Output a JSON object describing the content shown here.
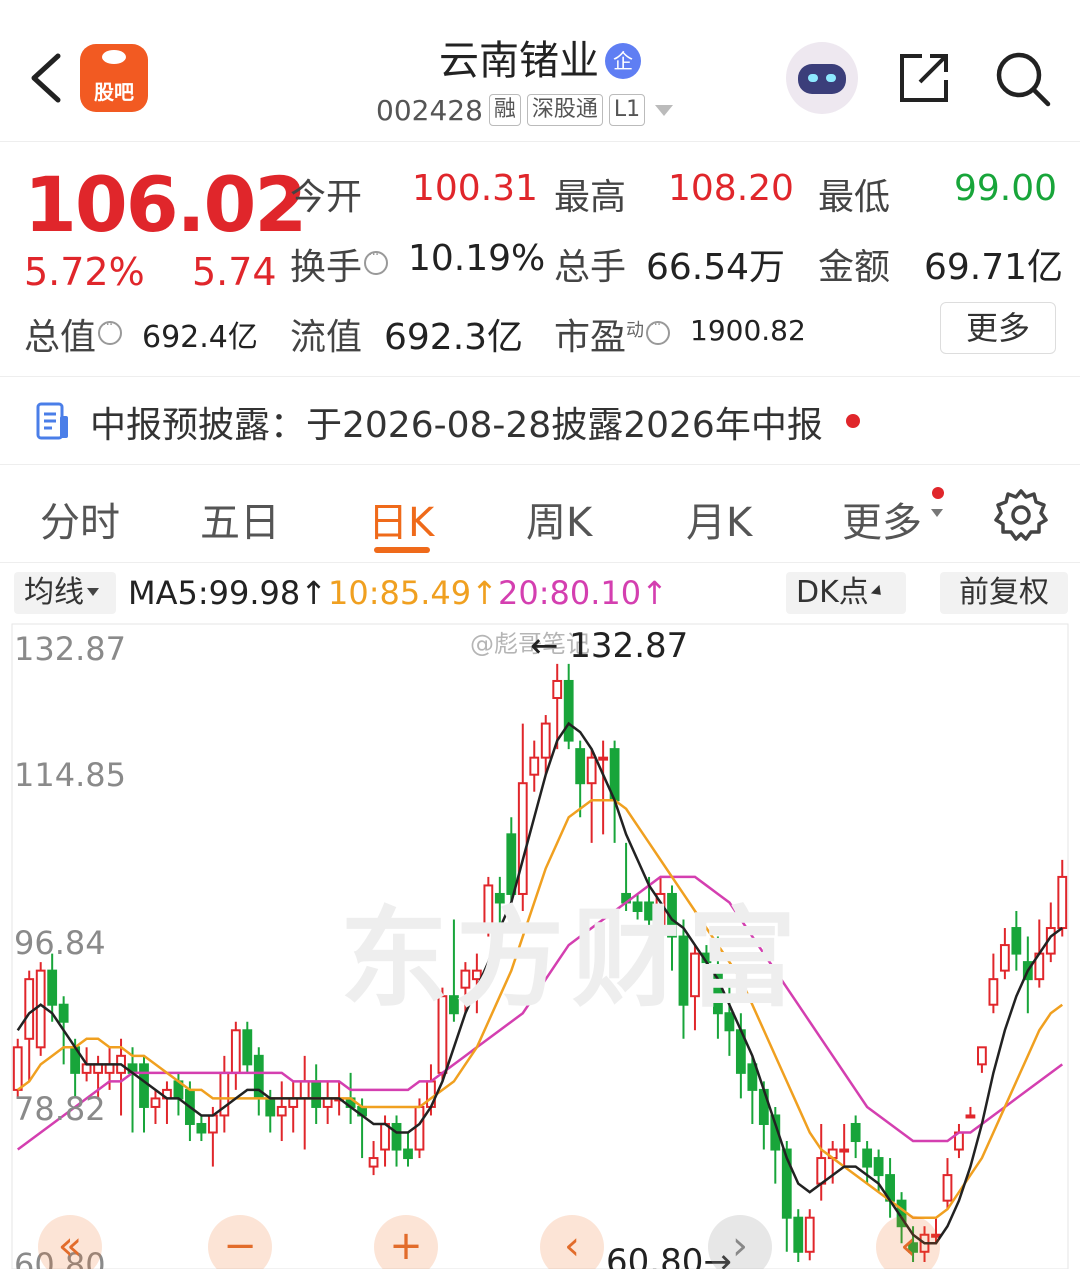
{
  "header": {
    "back_icon": "chevron-left-icon",
    "app_badge": "股吧",
    "stock_name": "云南锗业",
    "enterprise_badge": "企",
    "stock_code": "002428",
    "tags": [
      "融",
      "深股通",
      "L1"
    ],
    "share_icon": "share-icon",
    "search_icon": "search-icon"
  },
  "quote": {
    "price": "106.02",
    "change_pct": "5.72%",
    "change_amt": "5.74",
    "open_label": "今开",
    "open": "100.31",
    "high_label": "最高",
    "high": "108.20",
    "low_label": "最低",
    "low": "99.00",
    "turnover_label": "换手",
    "turnover": "10.19%",
    "volume_label": "总手",
    "volume": "66.54万",
    "amount_label": "金额",
    "amount": "69.71亿",
    "mktcap_label": "总值",
    "mktcap": "692.4亿",
    "float_label": "流值",
    "float_cap": "692.3亿",
    "pe_label": "市盈",
    "pe_sup": "动",
    "pe": "1900.82",
    "more_label": "更多"
  },
  "notice": {
    "text": "中报预披露：于2026-08-28披露2026年中报"
  },
  "tabs": [
    "分时",
    "五日",
    "日K",
    "周K",
    "月K",
    "更多"
  ],
  "active_tab": "日K",
  "indicators": {
    "selector": "均线",
    "ma5": "MA5:99.98↑",
    "ma10": "10:85.49↑",
    "ma20": "20:80.10↑",
    "dk_label": "DK点",
    "adjust_label": "前复权"
  },
  "colors": {
    "up": "#e0262b",
    "down": "#18a53a",
    "ma5": "#222222",
    "ma10": "#f0a020",
    "ma20": "#d43fb0",
    "accent": "#ef6a1a"
  },
  "chart_data": {
    "type": "candlestick",
    "y_ticks": [
      "132.87",
      "114.85",
      "96.84",
      "78.82",
      "60.80"
    ],
    "ylim": [
      60.8,
      132.87
    ],
    "high_marker": "← 132.87",
    "low_marker": "60.80→",
    "watermark": "东方财富",
    "source_watermark": "@彪哥笔记",
    "candles": [
      {
        "o": 81,
        "c": 86,
        "h": 87,
        "l": 80
      },
      {
        "o": 87,
        "c": 94,
        "h": 95,
        "l": 82
      },
      {
        "o": 86,
        "c": 95,
        "h": 96,
        "l": 85
      },
      {
        "o": 95,
        "c": 91,
        "h": 97,
        "l": 89
      },
      {
        "o": 91,
        "c": 89,
        "h": 92,
        "l": 84
      },
      {
        "o": 86,
        "c": 83,
        "h": 87,
        "l": 80
      },
      {
        "o": 83,
        "c": 84,
        "h": 86,
        "l": 82
      },
      {
        "o": 83,
        "c": 84,
        "h": 85,
        "l": 80
      },
      {
        "o": 83,
        "c": 84,
        "h": 86,
        "l": 81
      },
      {
        "o": 83,
        "c": 85,
        "h": 87,
        "l": 78
      },
      {
        "o": 84,
        "c": 83,
        "h": 86,
        "l": 76
      },
      {
        "o": 84,
        "c": 79,
        "h": 85,
        "l": 76
      },
      {
        "o": 79,
        "c": 80,
        "h": 81,
        "l": 77
      },
      {
        "o": 80,
        "c": 81,
        "h": 82,
        "l": 77
      },
      {
        "o": 82,
        "c": 80,
        "h": 83,
        "l": 78
      },
      {
        "o": 81,
        "c": 77,
        "h": 82,
        "l": 75
      },
      {
        "o": 77,
        "c": 76,
        "h": 78,
        "l": 75
      },
      {
        "o": 76,
        "c": 78,
        "h": 79,
        "l": 72
      },
      {
        "o": 78,
        "c": 83,
        "h": 85,
        "l": 76
      },
      {
        "o": 83,
        "c": 88,
        "h": 89,
        "l": 81
      },
      {
        "o": 88,
        "c": 84,
        "h": 89,
        "l": 83
      },
      {
        "o": 85,
        "c": 80,
        "h": 86,
        "l": 78
      },
      {
        "o": 80,
        "c": 78,
        "h": 81,
        "l": 76
      },
      {
        "o": 78,
        "c": 79,
        "h": 82,
        "l": 75
      },
      {
        "o": 79,
        "c": 80,
        "h": 82,
        "l": 76
      },
      {
        "o": 80,
        "c": 82,
        "h": 85,
        "l": 74
      },
      {
        "o": 82,
        "c": 79,
        "h": 84,
        "l": 77
      },
      {
        "o": 79,
        "c": 80,
        "h": 82,
        "l": 77
      },
      {
        "o": 80,
        "c": 80,
        "h": 82,
        "l": 78
      },
      {
        "o": 80,
        "c": 79,
        "h": 83,
        "l": 77
      },
      {
        "o": 79,
        "c": 78,
        "h": 80,
        "l": 73
      },
      {
        "o": 72,
        "c": 73,
        "h": 75,
        "l": 71
      },
      {
        "o": 74,
        "c": 77,
        "h": 78,
        "l": 72
      },
      {
        "o": 77,
        "c": 74,
        "h": 78,
        "l": 72
      },
      {
        "o": 74,
        "c": 73,
        "h": 76,
        "l": 72
      },
      {
        "o": 74,
        "c": 79,
        "h": 80,
        "l": 73
      },
      {
        "o": 79,
        "c": 82,
        "h": 84,
        "l": 78
      },
      {
        "o": 83,
        "c": 92,
        "h": 93,
        "l": 82
      },
      {
        "o": 92,
        "c": 90,
        "h": 101,
        "l": 89
      },
      {
        "o": 93,
        "c": 95,
        "h": 96,
        "l": 90
      },
      {
        "o": 94,
        "c": 95,
        "h": 97,
        "l": 90
      },
      {
        "o": 100,
        "c": 105,
        "h": 106,
        "l": 99
      },
      {
        "o": 104,
        "c": 103,
        "h": 106,
        "l": 98
      },
      {
        "o": 111,
        "c": 104,
        "h": 113,
        "l": 103
      },
      {
        "o": 104,
        "c": 117,
        "h": 124,
        "l": 102
      },
      {
        "o": 118,
        "c": 120,
        "h": 122,
        "l": 116
      },
      {
        "o": 120,
        "c": 124,
        "h": 125,
        "l": 118
      },
      {
        "o": 127,
        "c": 129,
        "h": 131,
        "l": 121
      },
      {
        "o": 129,
        "c": 122,
        "h": 131,
        "l": 121
      },
      {
        "o": 121,
        "c": 117,
        "h": 122,
        "l": 113
      },
      {
        "o": 117,
        "c": 120,
        "h": 121,
        "l": 110
      },
      {
        "o": 120,
        "c": 120,
        "h": 122,
        "l": 111
      },
      {
        "o": 121,
        "c": 115,
        "h": 122,
        "l": 110
      },
      {
        "o": 104,
        "c": 103,
        "h": 110,
        "l": 102
      },
      {
        "o": 103,
        "c": 102,
        "h": 104,
        "l": 101
      },
      {
        "o": 103,
        "c": 101,
        "h": 106,
        "l": 100
      },
      {
        "o": 100,
        "c": 104,
        "h": 106,
        "l": 99
      },
      {
        "o": 104,
        "c": 99,
        "h": 105,
        "l": 95
      },
      {
        "o": 99,
        "c": 91,
        "h": 101,
        "l": 87
      },
      {
        "o": 92,
        "c": 97,
        "h": 98,
        "l": 88
      },
      {
        "o": 97,
        "c": 96,
        "h": 98,
        "l": 92
      },
      {
        "o": 95,
        "c": 90,
        "h": 99,
        "l": 87
      },
      {
        "o": 90,
        "c": 88,
        "h": 93,
        "l": 85
      },
      {
        "o": 88,
        "c": 83,
        "h": 90,
        "l": 80
      },
      {
        "o": 84,
        "c": 81,
        "h": 85,
        "l": 77
      },
      {
        "o": 81,
        "c": 77,
        "h": 82,
        "l": 74
      },
      {
        "o": 78,
        "c": 74,
        "h": 79,
        "l": 70
      },
      {
        "o": 74,
        "c": 66,
        "h": 75,
        "l": 62
      },
      {
        "o": 66,
        "c": 62,
        "h": 67,
        "l": 60.8
      },
      {
        "o": 62,
        "c": 66,
        "h": 67,
        "l": 61
      },
      {
        "o": 70,
        "c": 73,
        "h": 77,
        "l": 68
      },
      {
        "o": 73,
        "c": 74,
        "h": 75,
        "l": 70
      },
      {
        "o": 74,
        "c": 74,
        "h": 77,
        "l": 72
      },
      {
        "o": 77,
        "c": 75,
        "h": 78,
        "l": 73
      },
      {
        "o": 74,
        "c": 72,
        "h": 75,
        "l": 70
      },
      {
        "o": 73,
        "c": 71,
        "h": 74,
        "l": 69
      },
      {
        "o": 71,
        "c": 68,
        "h": 73,
        "l": 66
      },
      {
        "o": 68,
        "c": 65,
        "h": 69,
        "l": 63
      },
      {
        "o": 63,
        "c": 62,
        "h": 65,
        "l": 60.8
      },
      {
        "o": 62,
        "c": 64,
        "h": 65,
        "l": 60.8
      },
      {
        "o": 64,
        "c": 64,
        "h": 66,
        "l": 63
      },
      {
        "o": 68,
        "c": 71,
        "h": 73,
        "l": 67
      },
      {
        "o": 74,
        "c": 76,
        "h": 77,
        "l": 73
      },
      {
        "o": 78,
        "c": 78,
        "h": 79,
        "l": 78
      },
      {
        "o": 84,
        "c": 86,
        "h": 86,
        "l": 83
      },
      {
        "o": 91,
        "c": 94,
        "h": 97,
        "l": 90
      },
      {
        "o": 95,
        "c": 98,
        "h": 100,
        "l": 94
      },
      {
        "o": 100,
        "c": 97,
        "h": 102,
        "l": 95
      },
      {
        "o": 96,
        "c": 94,
        "h": 99,
        "l": 90
      },
      {
        "o": 94,
        "c": 97,
        "h": 101,
        "l": 93
      },
      {
        "o": 97,
        "c": 100,
        "h": 103,
        "l": 96
      },
      {
        "o": 100,
        "c": 106,
        "h": 108,
        "l": 99
      }
    ],
    "ma5": [
      88,
      90,
      91,
      90,
      88,
      86,
      84,
      84,
      84,
      84,
      83,
      82,
      81,
      80,
      80,
      79,
      78,
      78,
      79,
      80,
      81,
      81,
      80,
      80,
      80,
      80,
      80,
      80,
      80,
      79,
      78,
      77,
      77,
      76,
      76,
      77,
      79,
      82,
      86,
      90,
      93,
      96,
      100,
      103,
      108,
      113,
      118,
      122,
      124,
      123,
      121,
      118,
      115,
      111,
      108,
      105,
      103,
      101,
      100,
      98,
      96,
      94,
      91,
      88,
      85,
      81,
      77,
      73,
      70,
      69,
      70,
      71,
      72,
      72,
      71,
      70,
      68,
      66,
      64,
      63,
      63,
      65,
      68,
      72,
      77,
      83,
      88,
      92,
      95,
      97,
      99,
      100
    ],
    "ma10": [
      81,
      82,
      84,
      85,
      86,
      86,
      87,
      87,
      86,
      86,
      85,
      85,
      84,
      83,
      82,
      81,
      81,
      80,
      80,
      80,
      80,
      80,
      80,
      80,
      80,
      80,
      80,
      80,
      80,
      80,
      79,
      79,
      79,
      79,
      79,
      79,
      80,
      81,
      82,
      84,
      86,
      89,
      92,
      95,
      99,
      103,
      107,
      110,
      113,
      114,
      115,
      115,
      115,
      114,
      112,
      110,
      108,
      106,
      104,
      102,
      100,
      98,
      96,
      94,
      91,
      88,
      85,
      82,
      79,
      76,
      74,
      73,
      72,
      71,
      70,
      69,
      68,
      67,
      66,
      66,
      66,
      67,
      69,
      71,
      73,
      76,
      79,
      82,
      85,
      88,
      90,
      91
    ],
    "ma20": [
      74,
      75,
      76,
      77,
      78,
      79,
      80,
      81,
      82,
      82,
      83,
      83,
      83,
      83,
      83,
      83,
      83,
      83,
      83,
      83,
      83,
      83,
      83,
      83,
      82,
      82,
      82,
      82,
      82,
      81,
      81,
      81,
      81,
      81,
      81,
      82,
      82,
      83,
      84,
      85,
      86,
      87,
      88,
      89,
      90,
      92,
      94,
      96,
      98,
      99,
      100,
      101,
      102,
      103,
      104,
      105,
      106,
      106,
      106,
      106,
      105,
      104,
      103,
      101,
      99,
      97,
      95,
      93,
      91,
      89,
      87,
      85,
      83,
      81,
      79,
      78,
      77,
      76,
      75,
      75,
      75,
      75,
      76,
      76,
      77,
      78,
      79,
      80,
      81,
      82,
      83,
      84
    ]
  },
  "chart_buttons": [
    "«",
    "−",
    "+",
    "‹",
    "›",
    "‹"
  ]
}
